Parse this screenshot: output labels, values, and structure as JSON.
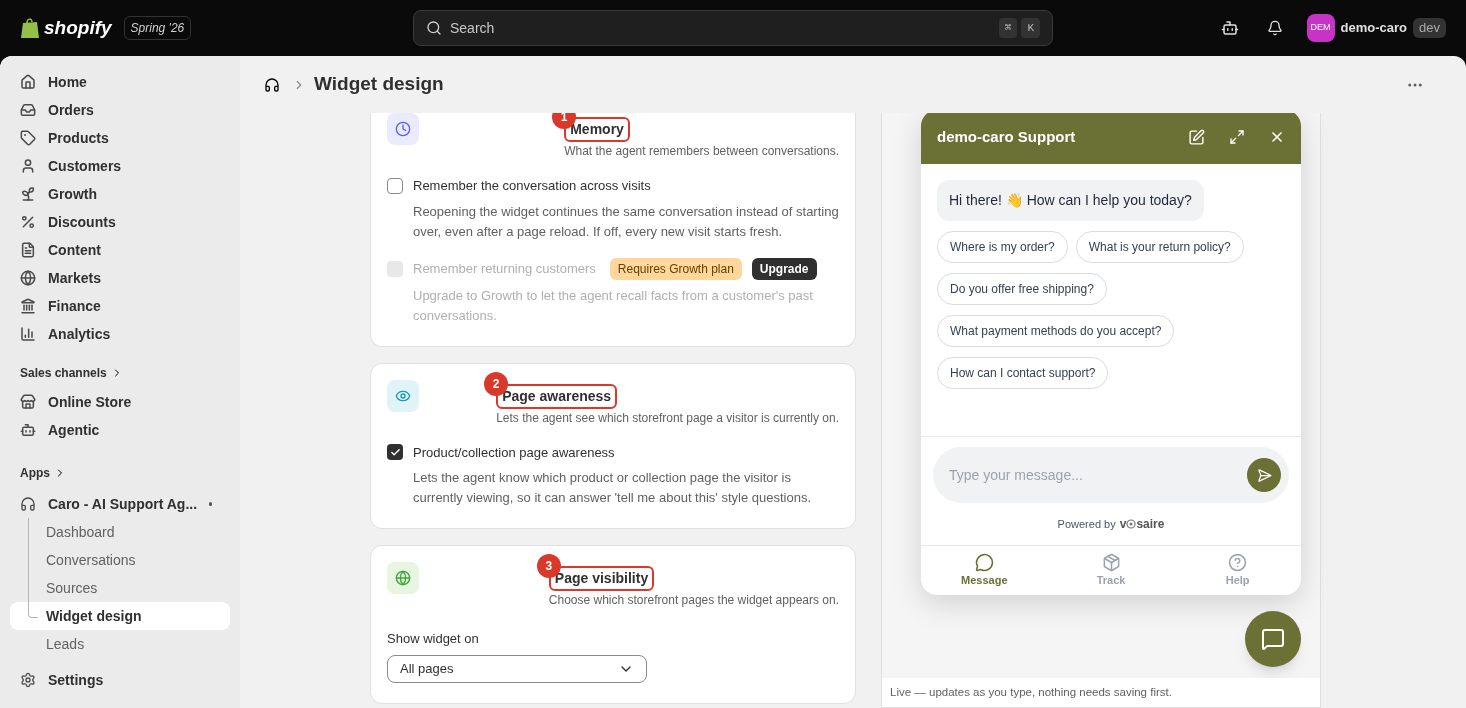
{
  "topbar": {
    "brand": "shopify",
    "edition": "Spring '26",
    "search": {
      "placeholder": "Search",
      "keys": [
        "⌘",
        "K"
      ]
    },
    "store": {
      "avatar": "DEM",
      "name": "demo-caro",
      "badge": "dev"
    }
  },
  "sidebar": {
    "items": [
      {
        "label": "Home",
        "selected": false
      },
      {
        "label": "Orders",
        "selected": false
      },
      {
        "label": "Products",
        "selected": false
      },
      {
        "label": "Customers",
        "selected": false
      },
      {
        "label": "Growth",
        "selected": false
      },
      {
        "label": "Discounts",
        "selected": false
      },
      {
        "label": "Content",
        "selected": false
      },
      {
        "label": "Markets",
        "selected": false
      },
      {
        "label": "Finance",
        "selected": false
      },
      {
        "label": "Analytics",
        "selected": false
      }
    ],
    "sales_channels": {
      "heading": "Sales channels",
      "items": [
        {
          "label": "Online Store",
          "selected": false
        },
        {
          "label": "Agentic",
          "selected": false
        }
      ]
    },
    "apps": {
      "heading": "Apps",
      "app": {
        "name": "Caro - AI Support Ag...",
        "children": [
          {
            "label": "Dashboard",
            "selected": false
          },
          {
            "label": "Conversations",
            "selected": false
          },
          {
            "label": "Sources",
            "selected": false
          },
          {
            "label": "Widget design",
            "selected": true
          },
          {
            "label": "Leads",
            "selected": false
          }
        ]
      }
    },
    "settings": "Settings"
  },
  "page": {
    "title": "Widget design"
  },
  "sections": [
    {
      "number": "1",
      "title": "Memory",
      "description": "What the agent remembers between conversations.",
      "controls": [
        {
          "kind": "checkbox",
          "label": "Remember the conversation across visits",
          "checked": false,
          "disabled": false,
          "help": "Reopening the widget continues the same conversation instead of starting over, even after a page reload. If off, every new visit starts fresh."
        },
        {
          "kind": "checkbox",
          "label": "Remember returning customers",
          "checked": false,
          "disabled": true,
          "badge": "Requires Growth plan",
          "button": "Upgrade",
          "help": "Upgrade to Growth to let the agent recall facts from a customer's past conversations."
        }
      ]
    },
    {
      "number": "2",
      "title": "Page awareness",
      "description": "Lets the agent see which storefront page a visitor is currently on.",
      "controls": [
        {
          "kind": "checkbox",
          "label": "Product/collection page awareness",
          "checked": true,
          "disabled": false,
          "help": "Lets the agent know which product or collection page the visitor is currently viewing, so it can answer 'tell me about this' style questions."
        }
      ]
    },
    {
      "number": "3",
      "title": "Page visibility",
      "description": "Choose which storefront pages the widget appears on.",
      "controls": [
        {
          "kind": "select",
          "label": "Show widget on",
          "value": "All pages"
        }
      ]
    }
  ],
  "preview": {
    "widget": {
      "title": "demo-caro Support",
      "greeting": "Hi there! 👋 How can I help you today?",
      "suggestions": [
        "Where is my order?",
        "What is your return policy?",
        "Do you offer free shipping?",
        "What payment methods do you accept?",
        "How can I contact support?"
      ],
      "input": {
        "placeholder": "Type your message..."
      },
      "powered_by": "Powered by",
      "brand": [
        "v",
        "saire"
      ],
      "tabs": [
        {
          "label": "Message",
          "selected": true
        },
        {
          "label": "Track",
          "selected": false
        },
        {
          "label": "Help",
          "selected": false
        }
      ]
    },
    "footer": "Live — updates as you type, nothing needs saving first."
  }
}
